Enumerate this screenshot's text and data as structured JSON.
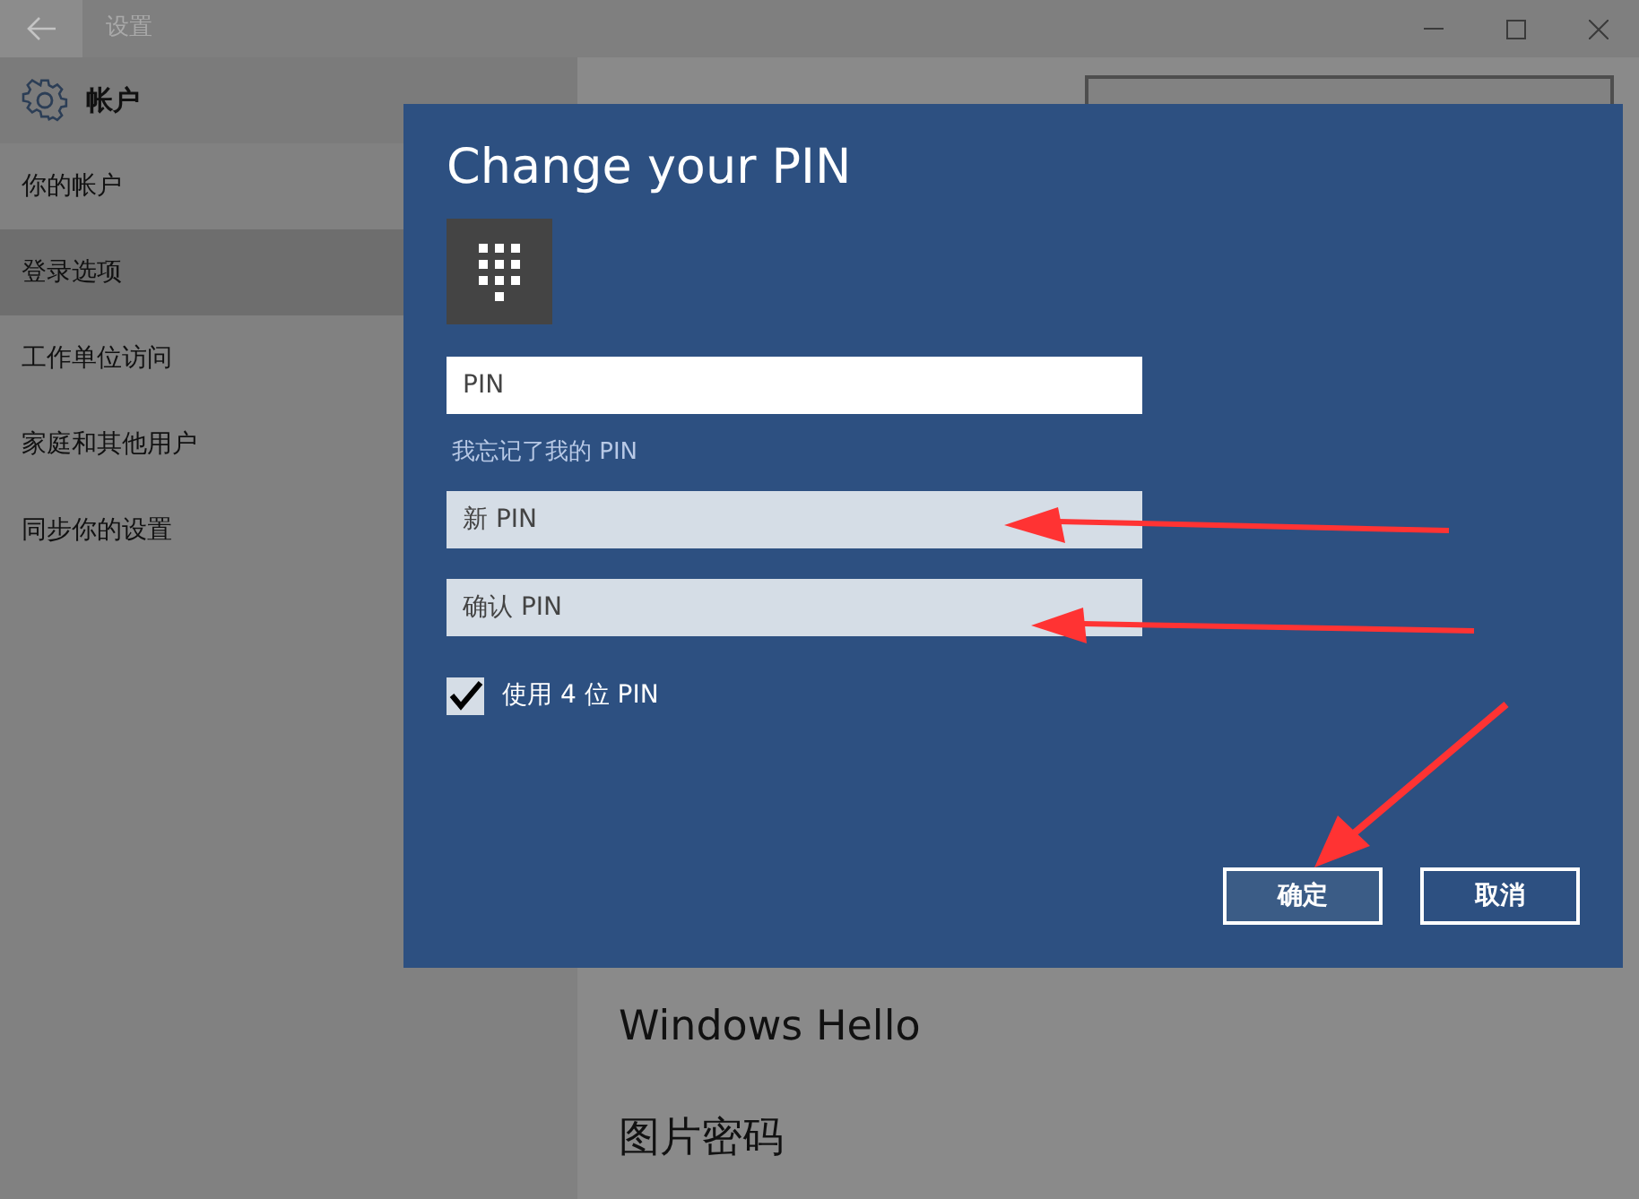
{
  "window": {
    "title": "设置"
  },
  "header": {
    "title": "帐户"
  },
  "sidebar": {
    "items": [
      {
        "label": "你的帐户",
        "selected": false
      },
      {
        "label": "登录选项",
        "selected": true
      },
      {
        "label": "工作单位访问",
        "selected": false
      },
      {
        "label": "家庭和其他用户",
        "selected": false
      },
      {
        "label": "同步你的设置",
        "selected": false
      }
    ]
  },
  "content": {
    "sections": [
      "Windows Hello",
      "图片密码"
    ]
  },
  "dialog": {
    "title": "Change your PIN",
    "fields": [
      {
        "placeholder": "PIN",
        "disabled": false
      },
      {
        "placeholder": "新 PIN",
        "disabled": true
      },
      {
        "placeholder": "确认 PIN",
        "disabled": true
      }
    ],
    "forgot_link": "我忘记了我的 PIN",
    "checkbox": {
      "label": "使用 4 位 PIN",
      "checked": true
    },
    "buttons": [
      {
        "label": "确定",
        "default": true
      },
      {
        "label": "取消",
        "default": false
      }
    ]
  }
}
